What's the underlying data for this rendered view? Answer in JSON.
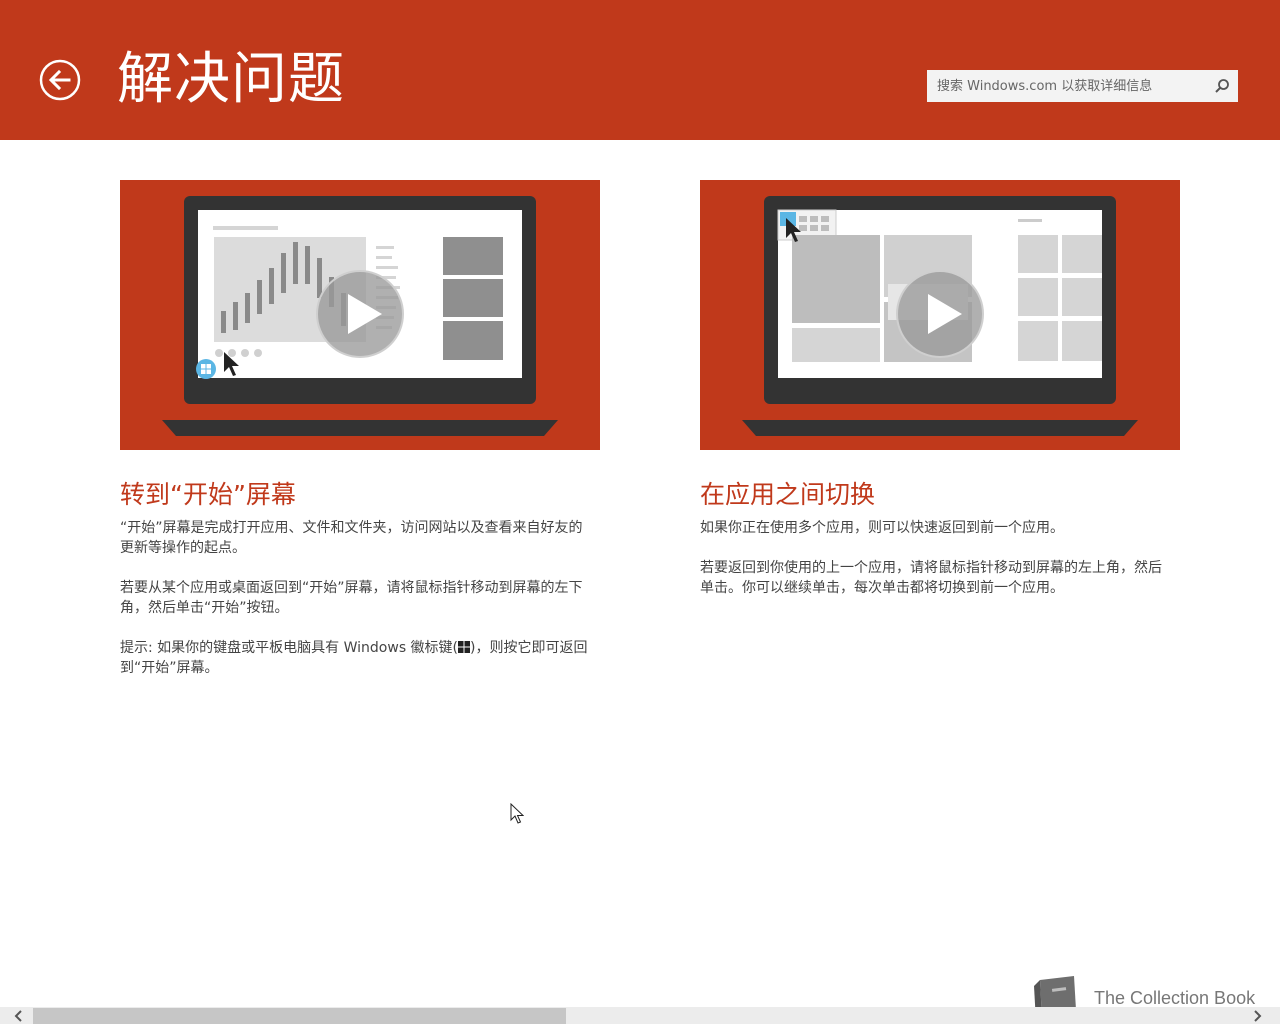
{
  "header": {
    "title": "解决问题",
    "search_placeholder": "搜索 Windows.com 以获取详细信息"
  },
  "cards": [
    {
      "heading": "转到“开始”屏幕",
      "paragraphs": [
        "“开始”屏幕是完成打开应用、文件和文件夹，访问网站以及查看来自好友的更新等操作的起点。",
        "若要从某个应用或桌面返回到“开始”屏幕，请将鼠标指针移动到屏幕的左下角，然后单击“开始”按钮。"
      ],
      "tip_before": "提示: 如果你的键盘或平板电脑具有 Windows 徽标键(",
      "tip_after": ")，则按它即可返回到“开始”屏幕。",
      "video_icon": "play-icon"
    },
    {
      "heading": "在应用之间切换",
      "paragraphs": [
        "如果你正在使用多个应用，则可以快速返回到前一个应用。",
        "若要返回到你使用的上一个应用，请将鼠标指针移动到屏幕的左上角，然后单击。你可以继续单击，每次单击都将切换到前一个应用。"
      ],
      "video_icon": "play-icon"
    }
  ],
  "brand": {
    "text": "The Collection Book",
    "icon": "book-icon"
  },
  "colors": {
    "accent": "#c0391b",
    "text": "#444444"
  }
}
